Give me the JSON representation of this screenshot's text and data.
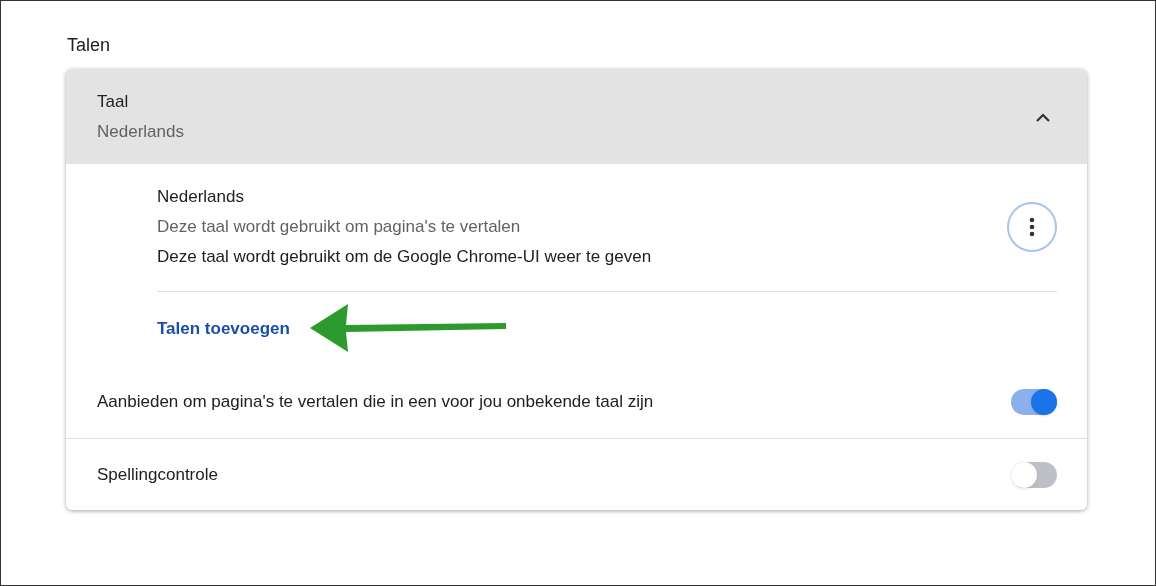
{
  "section_title": "Talen",
  "card": {
    "header": {
      "title": "Taal",
      "subtitle": "Nederlands",
      "expanded": true
    },
    "languages": [
      {
        "name": "Nederlands",
        "lines": [
          {
            "text": "Deze taal wordt gebruikt om pagina's te vertalen",
            "kind": "muted"
          },
          {
            "text": "Deze taal wordt gebruikt om de Google Chrome-UI weer te geven",
            "kind": "plain"
          }
        ]
      }
    ],
    "add_link": "Talen toevoegen",
    "settings": [
      {
        "label": "Aanbieden om pagina's te vertalen die in een voor jou onbekende taal zijn",
        "on": true
      },
      {
        "label": "Spellingcontrole",
        "on": false
      }
    ]
  }
}
